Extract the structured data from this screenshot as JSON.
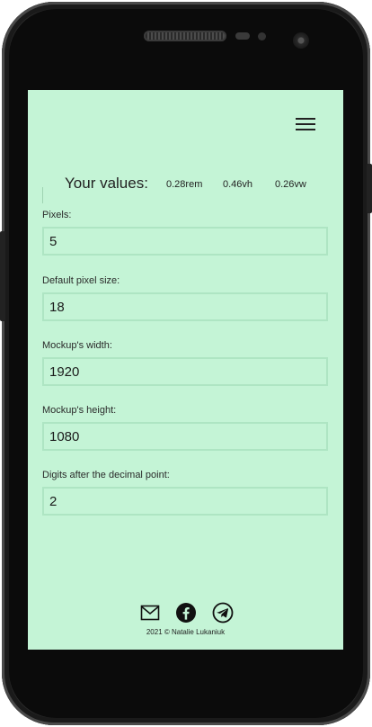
{
  "header": {
    "menu_icon": "hamburger-menu-icon"
  },
  "values": {
    "title": "Your values:",
    "rem": "0.28rem",
    "vh": "0.46vh",
    "vw": "0.26vw"
  },
  "form": {
    "fields": [
      {
        "label": "Pixels:",
        "value": "5"
      },
      {
        "label": "Default pixel size:",
        "value": "18"
      },
      {
        "label": "Mockup's width:",
        "value": "1920"
      },
      {
        "label": "Mockup's height:",
        "value": "1080"
      },
      {
        "label": "Digits after the decimal point:",
        "value": "2"
      }
    ]
  },
  "footer": {
    "icons": [
      "mail-icon",
      "facebook-icon",
      "telegram-icon"
    ],
    "copyright": "2021 © Natalie Lukaniuk"
  },
  "colors": {
    "screen_background": "#c4f4d6",
    "input_border": "#aee5c3"
  }
}
